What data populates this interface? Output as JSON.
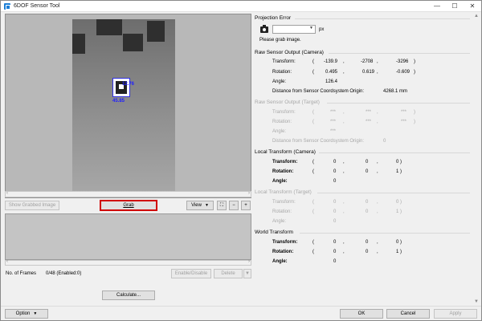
{
  "window": {
    "title": "6DOF Sensor Tool",
    "min": "—",
    "max": "☐",
    "close": "✕"
  },
  "viewer": {
    "marker_labels": [
      "12.76",
      "45.85"
    ],
    "scroll_left": "‹",
    "scroll_right": "›"
  },
  "toolbar": {
    "show_grabbed": "Show Grabbed Image",
    "grab": "Grab",
    "view": "View",
    "fit_icon": "⛶",
    "zoom_out": "−",
    "zoom_in": "+"
  },
  "thumbs_scroll": {
    "left": "‹",
    "right": "›"
  },
  "frames": {
    "label": "No. of Frames",
    "value": "0/48 (Enabled:0)",
    "enable_disable": "Enable/Disable",
    "delete": "Delete"
  },
  "calculate": "Calculate...",
  "footer": {
    "option": "Option",
    "ok": "OK",
    "cancel": "Cancel",
    "apply": "Apply"
  },
  "projection_error": {
    "title": "Projection Error",
    "value": "",
    "unit": "px",
    "message": "Please grab image."
  },
  "raw_camera": {
    "title": "Raw Sensor Output (Camera)",
    "transform_label": "Transform:",
    "transform": [
      "-139.9",
      "-2708",
      "-3296"
    ],
    "rotation_label": "Rotation:",
    "rotation": [
      "0.495",
      "0.619",
      "-0.609"
    ],
    "angle_label": "Angle:",
    "angle": "126.4",
    "distance_label": "Distance from Sensor Coordsystem Origin:",
    "distance": "4268.1 mm"
  },
  "raw_target": {
    "title": "Raw Sensor Output (Target)",
    "transform_label": "Transform:",
    "transform": [
      "***",
      "***",
      "***"
    ],
    "rotation_label": "Rotation:",
    "rotation": [
      "***",
      "***",
      "***"
    ],
    "angle_label": "Angle:",
    "angle": "***",
    "distance_label": "Distance from Sensor Coordsystem Origin:",
    "distance": "0"
  },
  "local_camera": {
    "title": "Local Transform (Camera)",
    "transform_label": "Transform:",
    "transform": [
      "0",
      "0",
      "0"
    ],
    "rotation_label": "Rotation:",
    "rotation": [
      "0",
      "0",
      "1"
    ],
    "angle_label": "Angle:",
    "angle": "0"
  },
  "local_target": {
    "title": "Local Transform (Target)",
    "transform_label": "Transform:",
    "transform": [
      "0",
      "0",
      "0"
    ],
    "rotation_label": "Rotation:",
    "rotation": [
      "0",
      "0",
      "1"
    ],
    "angle_label": "Angle:",
    "angle": "0"
  },
  "world": {
    "title": "World Transform",
    "transform_label": "Transform:",
    "transform": [
      "0",
      "0",
      "0"
    ],
    "rotation_label": "Rotation:",
    "rotation": [
      "0",
      "0",
      "1"
    ],
    "angle_label": "Angle:",
    "angle": "0"
  },
  "punct": {
    "open": "(",
    "close": ")",
    "comma": ","
  }
}
